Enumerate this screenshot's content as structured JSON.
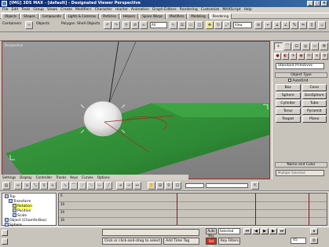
{
  "window": {
    "title": "[IMG] 3DS MAX - [default] - Designated Viewer Perspective",
    "min": "_",
    "max": "□",
    "close": "×"
  },
  "menu": [
    "File",
    "Edit",
    "Tools",
    "Group",
    "Views",
    "Create",
    "Modifiers",
    "Character",
    "reactor",
    "Animation",
    "Graph Editors",
    "Rendering",
    "Customize",
    "MAXScript",
    "Help"
  ],
  "tabs": [
    {
      "label": "Objects",
      "active": false
    },
    {
      "label": "Shapes",
      "active": false
    },
    {
      "label": "Compounds",
      "active": false
    },
    {
      "label": "Lights & Cameras",
      "active": false
    },
    {
      "label": "Particles",
      "active": false
    },
    {
      "label": "Helpers",
      "active": false
    },
    {
      "label": "Space Warps",
      "active": false
    },
    {
      "label": "Modifiers",
      "active": false
    },
    {
      "label": "Modeling",
      "active": false
    },
    {
      "label": "Rendering",
      "active": true
    }
  ],
  "toolbar": {
    "label_a": "Containers",
    "label_b": "Objects",
    "label_c": "Polygon",
    "label_d": "Shell Objects",
    "select_filter": "All",
    "ref_coord": "View"
  },
  "viewport": {
    "label": "Perspective"
  },
  "command_panel": {
    "tabs": [
      "+",
      "⌒",
      "⊡",
      "◎",
      "▭",
      "⚒"
    ],
    "category_icons": [
      "●",
      "◐",
      "☀",
      "◉",
      "⦿",
      "≋",
      "⚙"
    ],
    "dropdown": "Standard Primitives",
    "rollout_object_type": "Object Type",
    "autogrid_label": "AutoGrid",
    "buttons": [
      "Box",
      "Cone",
      "Sphere",
      "GeoSphere",
      "Cylinder",
      "Tube",
      "Torus",
      "Pyramid",
      "Teapot",
      "Plane"
    ],
    "rollout_name_color": "Name and Color",
    "name_value": "Multiple Selected"
  },
  "trackview": {
    "menu": [
      "Settings",
      "Display",
      "Controller",
      "Tracks",
      "Keys",
      "Curves",
      "Options"
    ],
    "tree": [
      {
        "label": "Top",
        "selected": false
      },
      {
        "label": "Transform",
        "selected": false
      },
      {
        "label": "Rotation",
        "selected": true
      },
      {
        "label": "Position",
        "selected": false
      },
      {
        "label": "Scale",
        "selected": false
      },
      {
        "label": "Object (ChamferBox)",
        "selected": false
      },
      {
        "label": "Sphere",
        "selected": false
      }
    ],
    "row_numbers": [
      "0",
      "10",
      "20",
      "30"
    ]
  },
  "status": {
    "prompt": "Click or click-and-drag to select objects",
    "add_time_tag": "Add Time Tag",
    "auto_key": "Auto Key",
    "set_key": "Set Key",
    "selected_dropdown": "Selected",
    "key_filters": "Key Filters...",
    "frame_value": "45"
  }
}
